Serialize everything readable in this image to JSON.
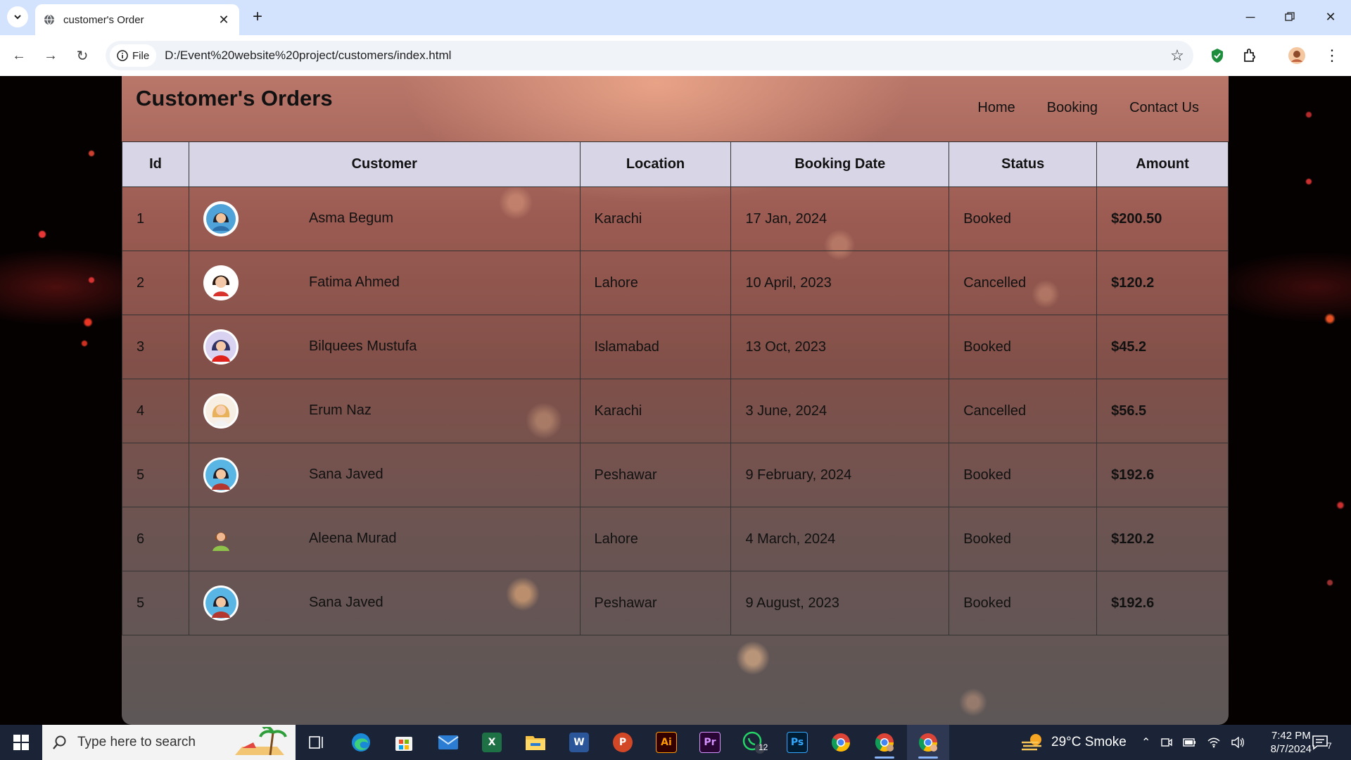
{
  "browser": {
    "tab_title": "customer's Order",
    "site_chip": "File",
    "url": "D:/Event%20website%20project/customers/index.html"
  },
  "page": {
    "title": "Customer's Orders",
    "nav": [
      "Home",
      "Booking",
      "Contact Us"
    ]
  },
  "table": {
    "columns": [
      "Id",
      "Customer",
      "Location",
      "Booking Date",
      "Status",
      "Amount"
    ],
    "rows": [
      {
        "id": "1",
        "customer": "Asma Begum",
        "location": "Karachi",
        "date": "17 Jan, 2024",
        "status": "Booked",
        "amount": "$200.50"
      },
      {
        "id": "2",
        "customer": "Fatima Ahmed",
        "location": "Lahore",
        "date": "10 April, 2023",
        "status": "Cancelled",
        "amount": "$120.2"
      },
      {
        "id": "3",
        "customer": "Bilquees Mustufa",
        "location": "Islamabad",
        "date": "13 Oct, 2023",
        "status": "Booked",
        "amount": "$45.2"
      },
      {
        "id": "4",
        "customer": "Erum Naz",
        "location": "Karachi",
        "date": "3 June, 2024",
        "status": "Cancelled",
        "amount": "$56.5"
      },
      {
        "id": "5",
        "customer": "Sana Javed",
        "location": "Peshawar",
        "date": "9 February, 2024",
        "status": "Booked",
        "amount": "$192.6"
      },
      {
        "id": "6",
        "customer": "Aleena Murad",
        "location": "Lahore",
        "date": "4 March, 2024",
        "status": "Booked",
        "amount": "$120.2"
      },
      {
        "id": "5",
        "customer": "Sana Javed",
        "location": "Peshawar",
        "date": "9 August, 2023",
        "status": "Booked",
        "amount": "$192.6"
      }
    ]
  },
  "colors": {
    "booked": "#17d417",
    "cancelled": "#e01010",
    "header_bg": "#d8d6e6"
  },
  "taskbar": {
    "search_placeholder": "Type here to search",
    "whatsapp_badge": "12",
    "weather": "29°C  Smoke",
    "time": "7:42 PM",
    "date": "8/7/2024",
    "notification_count": "7"
  }
}
